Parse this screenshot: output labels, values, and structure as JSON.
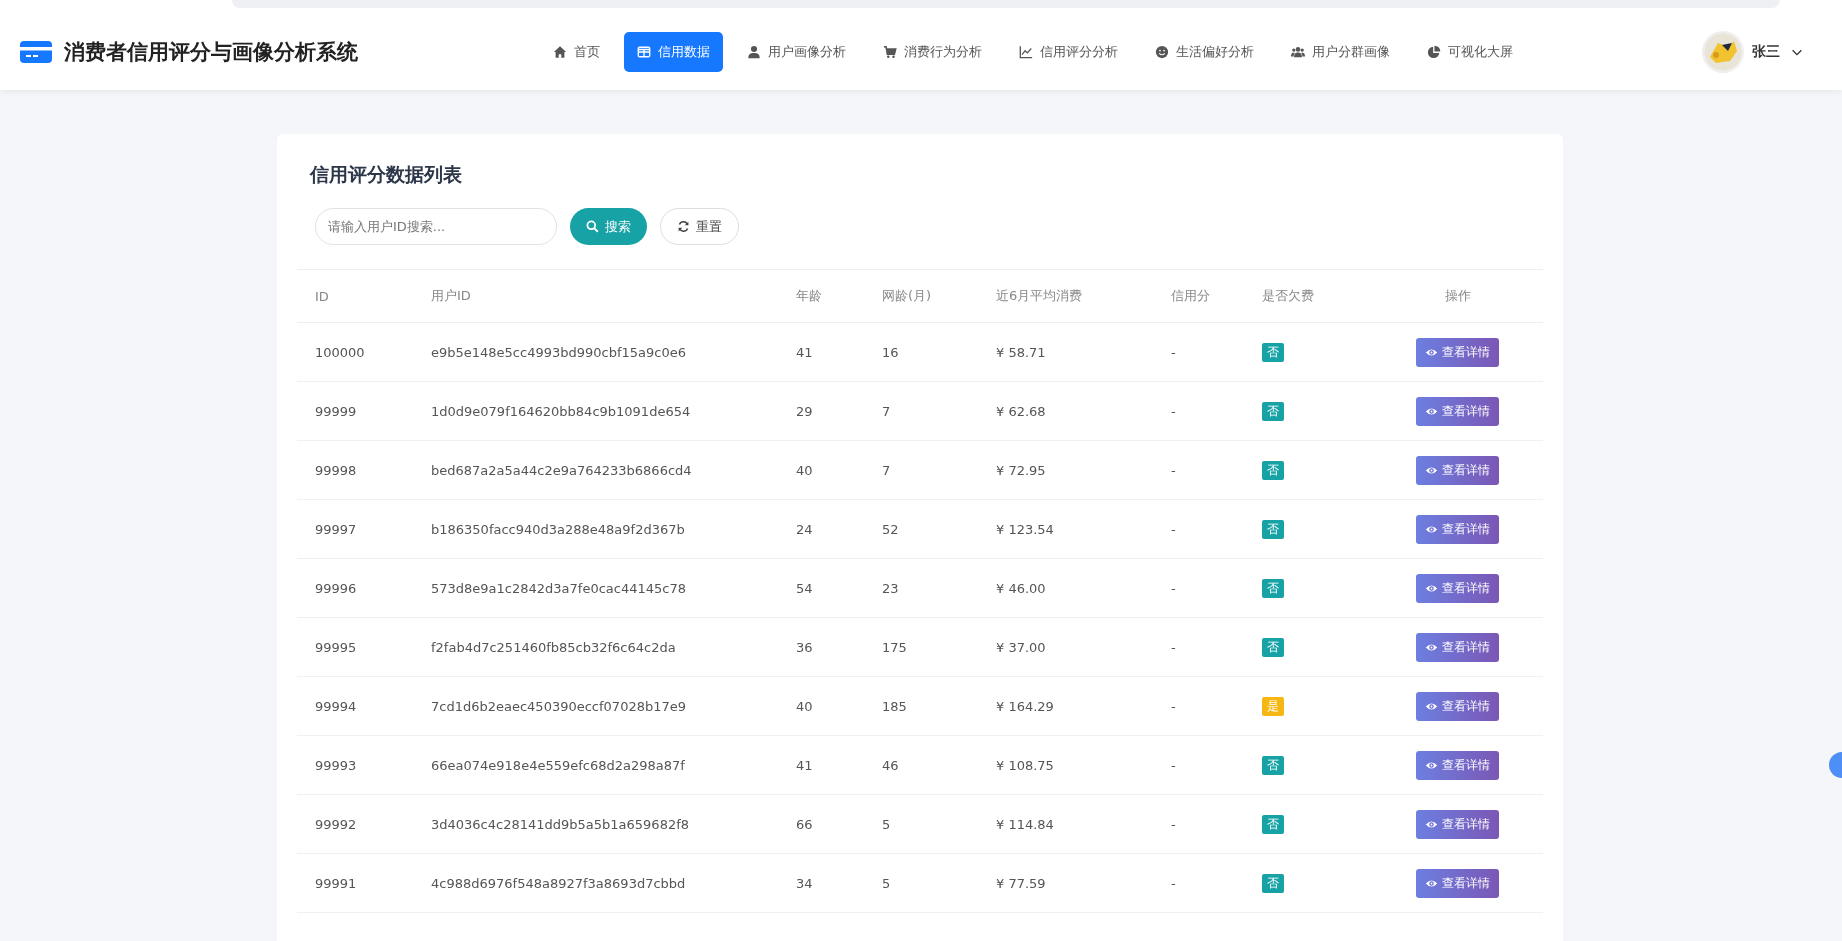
{
  "app": {
    "title": "消费者信用评分与画像分析系统"
  },
  "nav": [
    {
      "label": "首页",
      "kind": "home",
      "selected": false
    },
    {
      "label": "信用数据",
      "kind": "table",
      "selected": true
    },
    {
      "label": "用户画像分析",
      "kind": "user",
      "selected": false
    },
    {
      "label": "消费行为分析",
      "kind": "cart",
      "selected": false
    },
    {
      "label": "信用评分分析",
      "kind": "chart",
      "selected": false
    },
    {
      "label": "生活偏好分析",
      "kind": "smile",
      "selected": false
    },
    {
      "label": "用户分群画像",
      "kind": "users",
      "selected": false
    },
    {
      "label": "可视化大屏",
      "kind": "pie",
      "selected": false
    }
  ],
  "user": {
    "name": "张三"
  },
  "panel": {
    "title": "信用评分数据列表",
    "search": {
      "placeholder": "请输入用户ID搜索..."
    },
    "search_button": "搜索",
    "reset_button": "重置"
  },
  "table": {
    "columns": [
      "ID",
      "用户ID",
      "年龄",
      "网龄(月)",
      "近6月平均消费",
      "信用分",
      "是否欠费",
      "操作"
    ],
    "rows": [
      {
        "id": "100000",
        "user_id": "e9b5e148e5cc4993bd990cbf15a9c0e6",
        "age": "41",
        "tenure": "16",
        "spend": "¥ 58.71",
        "score": "-",
        "overdue": {
          "text": "否",
          "kind": "no"
        },
        "action": "查看详情"
      },
      {
        "id": "99999",
        "user_id": "1d0d9e079f164620bb84c9b1091de654",
        "age": "29",
        "tenure": "7",
        "spend": "¥ 62.68",
        "score": "-",
        "overdue": {
          "text": "否",
          "kind": "no"
        },
        "action": "查看详情"
      },
      {
        "id": "99998",
        "user_id": "bed687a2a5a44c2e9a764233b6866cd4",
        "age": "40",
        "tenure": "7",
        "spend": "¥ 72.95",
        "score": "-",
        "overdue": {
          "text": "否",
          "kind": "no"
        },
        "action": "查看详情"
      },
      {
        "id": "99997",
        "user_id": "b186350facc940d3a288e48a9f2d367b",
        "age": "24",
        "tenure": "52",
        "spend": "¥ 123.54",
        "score": "-",
        "overdue": {
          "text": "否",
          "kind": "no"
        },
        "action": "查看详情"
      },
      {
        "id": "99996",
        "user_id": "573d8e9a1c2842d3a7fe0cac44145c78",
        "age": "54",
        "tenure": "23",
        "spend": "¥ 46.00",
        "score": "-",
        "overdue": {
          "text": "否",
          "kind": "no"
        },
        "action": "查看详情"
      },
      {
        "id": "99995",
        "user_id": "f2fab4d7c251460fb85cb32f6c64c2da",
        "age": "36",
        "tenure": "175",
        "spend": "¥ 37.00",
        "score": "-",
        "overdue": {
          "text": "否",
          "kind": "no"
        },
        "action": "查看详情"
      },
      {
        "id": "99994",
        "user_id": "7cd1d6b2eaec450390eccf07028b17e9",
        "age": "40",
        "tenure": "185",
        "spend": "¥ 164.29",
        "score": "-",
        "overdue": {
          "text": "是",
          "kind": "yes"
        },
        "action": "查看详情"
      },
      {
        "id": "99993",
        "user_id": "66ea074e918e4e559efc68d2a298a87f",
        "age": "41",
        "tenure": "46",
        "spend": "¥ 108.75",
        "score": "-",
        "overdue": {
          "text": "否",
          "kind": "no"
        },
        "action": "查看详情"
      },
      {
        "id": "99992",
        "user_id": "3d4036c4c28141dd9b5a5b1a659682f8",
        "age": "66",
        "tenure": "5",
        "spend": "¥ 114.84",
        "score": "-",
        "overdue": {
          "text": "否",
          "kind": "no"
        },
        "action": "查看详情"
      },
      {
        "id": "99991",
        "user_id": "4c988d6976f548a8927f3a8693d7cbbd",
        "age": "34",
        "tenure": "5",
        "spend": "¥ 77.59",
        "score": "-",
        "overdue": {
          "text": "否",
          "kind": "no"
        },
        "action": "查看详情"
      }
    ]
  }
}
